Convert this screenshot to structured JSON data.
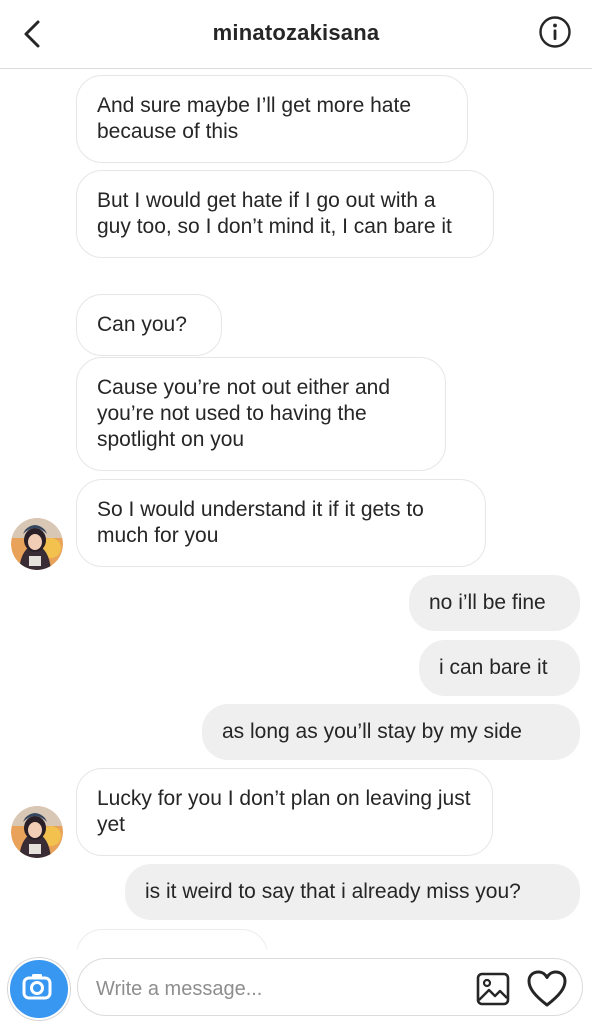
{
  "header": {
    "title": "minatozakisana",
    "back_icon": "chevron-left-icon",
    "info_icon": "info-icon"
  },
  "messages": [
    {
      "side": "in",
      "text": "And sure maybe I’ll get more hate because of this"
    },
    {
      "side": "in",
      "text": "But I would get hate if I go out with a guy too, so I don’t mind it, I can bare it"
    },
    {
      "side": "in",
      "text": "Can you?"
    },
    {
      "side": "in",
      "text": "Cause you’re not out either and you’re not used to having the spotlight on you"
    },
    {
      "side": "in",
      "text": "So I would understand it if it gets to much for you"
    },
    {
      "side": "out",
      "text": "no i’ll be fine"
    },
    {
      "side": "out",
      "text": "i can bare it"
    },
    {
      "side": "out",
      "text": "as long as you’ll stay by my side"
    },
    {
      "side": "in",
      "text": "Lucky for you I don’t plan on leaving just yet"
    },
    {
      "side": "out",
      "text": "is it weird to say that i already miss you?"
    }
  ],
  "composer": {
    "placeholder": "Write a message...",
    "camera_icon": "camera-icon",
    "gallery_icon": "gallery-icon",
    "heart_icon": "heart-icon"
  },
  "colors": {
    "accent": "#3897f0",
    "outgoing_bubble": "#efefef",
    "incoming_border": "#e6e6e6",
    "text": "#262626",
    "divider": "#dbdbdb"
  }
}
